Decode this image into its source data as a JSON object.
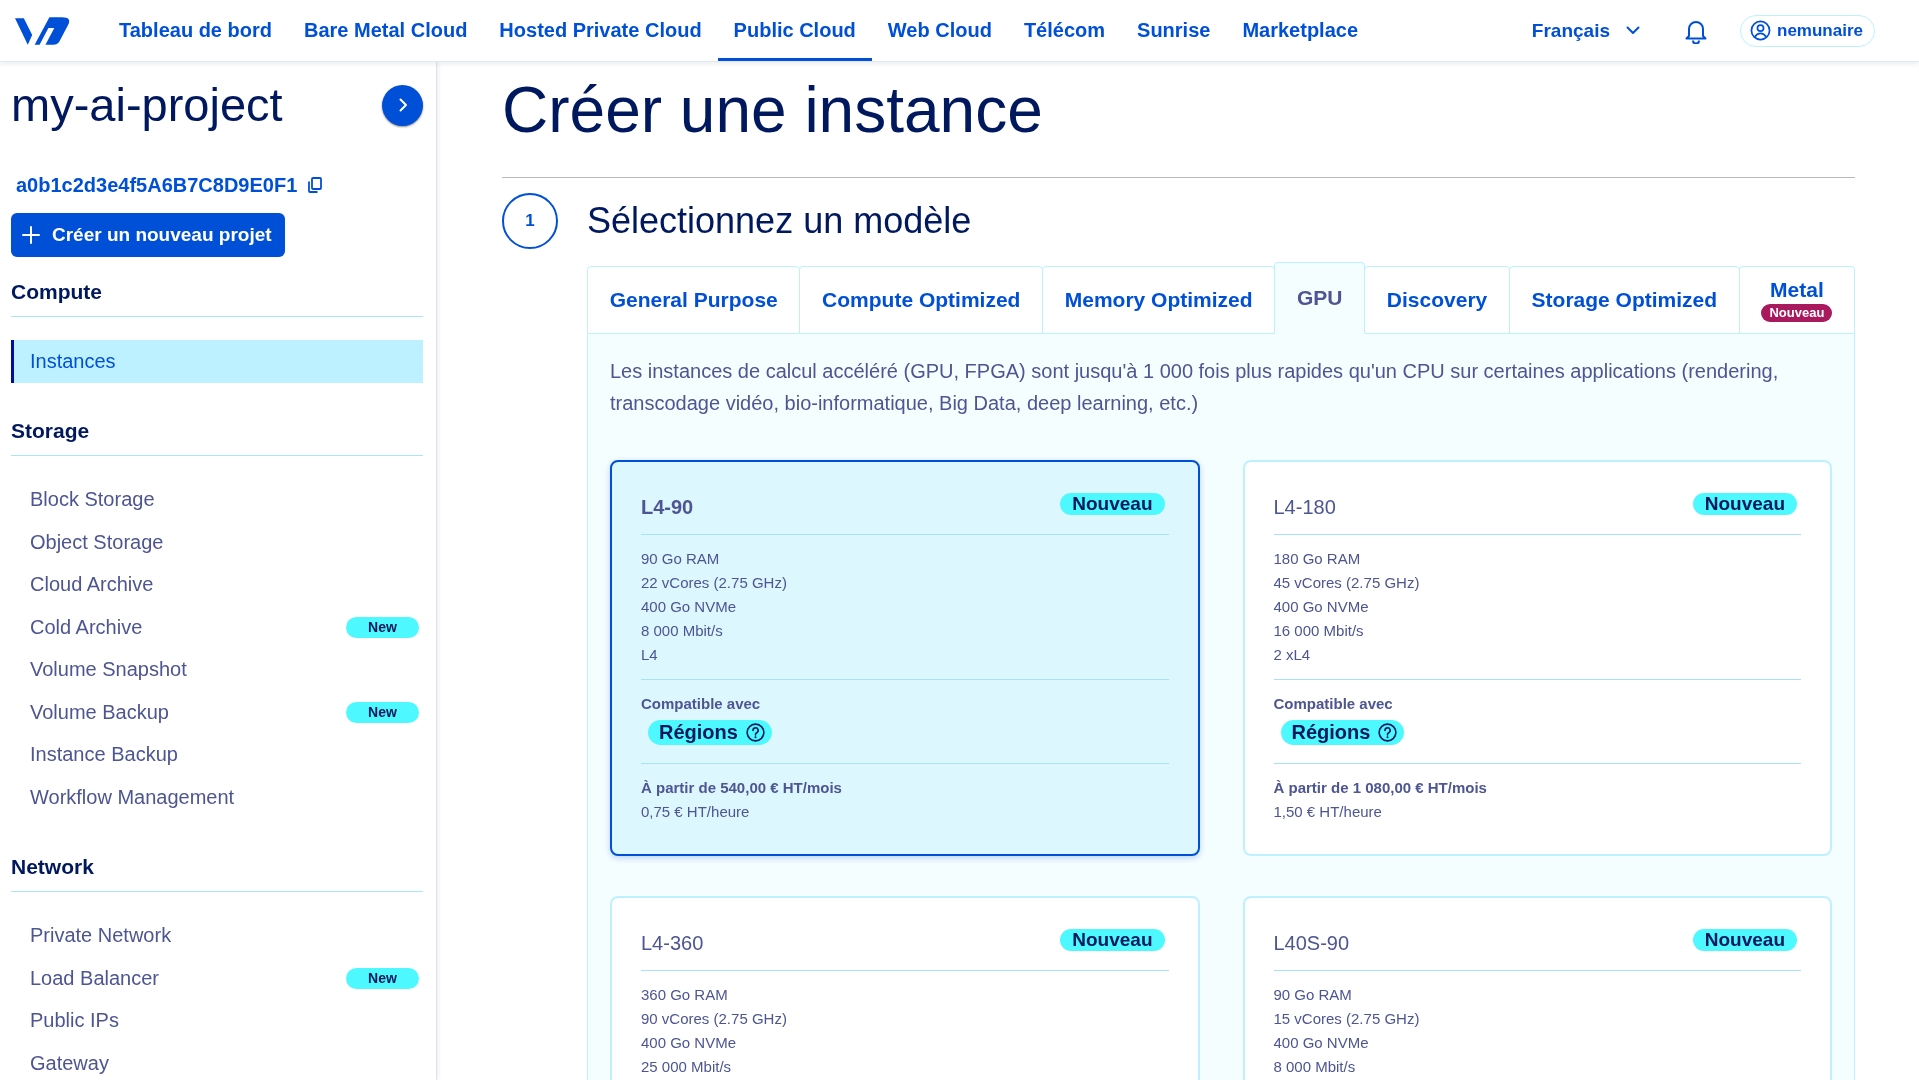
{
  "top_nav": {
    "items": [
      {
        "label": "Tableau de bord",
        "selected": false
      },
      {
        "label": "Bare Metal Cloud",
        "selected": false
      },
      {
        "label": "Hosted Private Cloud",
        "selected": false
      },
      {
        "label": "Public Cloud",
        "selected": true
      },
      {
        "label": "Web Cloud",
        "selected": false
      },
      {
        "label": "Télécom",
        "selected": false
      },
      {
        "label": "Sunrise",
        "selected": false
      },
      {
        "label": "Marketplace",
        "selected": false
      }
    ],
    "language": "Français",
    "user": "nemunaire"
  },
  "sidebar": {
    "project_name": "my-ai-project",
    "project_id": "a0b1c2d3e4f5A6B7C8D9E0F1",
    "new_project_button": "Créer un nouveau projet",
    "sections": [
      {
        "title": "Compute",
        "items": [
          {
            "label": "Instances",
            "selected": true
          }
        ]
      },
      {
        "title": "Storage",
        "items": [
          {
            "label": "Block Storage",
            "selected": false
          },
          {
            "label": "Object Storage",
            "selected": false
          },
          {
            "label": "Cloud Archive",
            "selected": false
          },
          {
            "label": "Cold Archive",
            "selected": false,
            "badge": "New"
          },
          {
            "label": "Volume Snapshot",
            "selected": false
          },
          {
            "label": "Volume Backup",
            "selected": false,
            "badge": "New"
          },
          {
            "label": "Instance Backup",
            "selected": false
          },
          {
            "label": "Workflow Management",
            "selected": false
          }
        ]
      },
      {
        "title": "Network",
        "items": [
          {
            "label": "Private Network",
            "selected": false
          },
          {
            "label": "Load Balancer",
            "selected": false,
            "badge": "New"
          },
          {
            "label": "Public IPs",
            "selected": false
          },
          {
            "label": "Gateway",
            "selected": false
          }
        ]
      }
    ]
  },
  "main": {
    "title": "Créer une instance",
    "step": {
      "number": "1",
      "title": "Sélectionnez un modèle"
    },
    "tabs": [
      {
        "label": "General Purpose",
        "selected": false
      },
      {
        "label": "Compute Optimized",
        "selected": false
      },
      {
        "label": "Memory Optimized",
        "selected": false
      },
      {
        "label": "GPU",
        "selected": true
      },
      {
        "label": "Discovery",
        "selected": false
      },
      {
        "label": "Storage Optimized",
        "selected": false
      },
      {
        "label": "Metal",
        "selected": false,
        "badge": "Nouveau"
      }
    ],
    "description": "Les instances de calcul accéléré (GPU, FPGA) sont jusqu'à 1 000 fois plus rapides qu'un CPU sur certaines applications (rendering, transcodage vidéo, bio-informatique, Big Data, deep learning, etc.)",
    "cards": [
      {
        "name": "L4-90",
        "selected": true,
        "badge": "Nouveau",
        "specs": [
          "90 Go RAM",
          "22 vCores (2.75 GHz)",
          "400 Go NVMe",
          "8 000 Mbit/s",
          "L4"
        ],
        "compatible_label": "Compatible avec",
        "regions_label": "Régions",
        "price": "À partir de 540,00 € HT/mois",
        "hourly_price": "0,75 € HT/heure"
      },
      {
        "name": "L4-180",
        "selected": false,
        "badge": "Nouveau",
        "specs": [
          "180 Go RAM",
          "45 vCores (2.75 GHz)",
          "400 Go NVMe",
          "16 000 Mbit/s",
          "2 xL4"
        ],
        "compatible_label": "Compatible avec",
        "regions_label": "Régions",
        "price": "À partir de 1 080,00 € HT/mois",
        "hourly_price": "1,50 € HT/heure"
      },
      {
        "name": "L4-360",
        "selected": false,
        "badge": "Nouveau",
        "specs": [
          "360 Go RAM",
          "90 vCores (2.75 GHz)",
          "400 Go NVMe",
          "25 000 Mbit/s"
        ]
      },
      {
        "name": "L40S-90",
        "selected": false,
        "badge": "Nouveau",
        "specs": [
          "90 Go RAM",
          "15 vCores (2.75 GHz)",
          "400 Go NVMe",
          "8 000 Mbit/s"
        ]
      }
    ]
  }
}
